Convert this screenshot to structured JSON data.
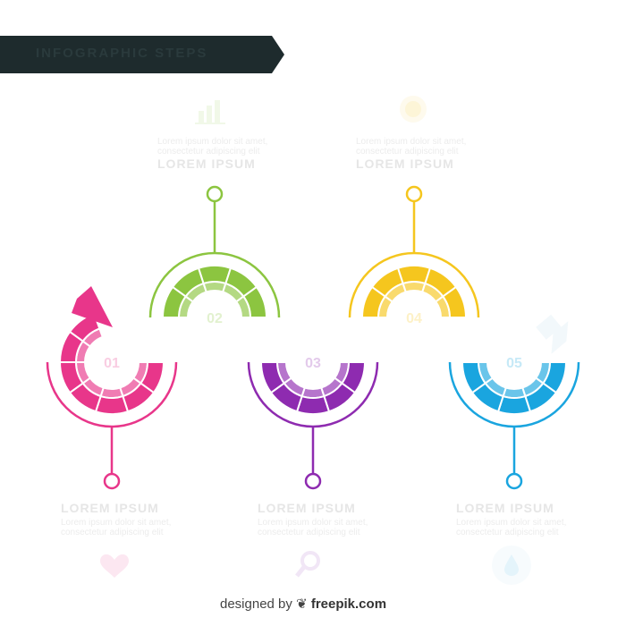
{
  "title": "INFOGRAPHIC STEPS",
  "colors": {
    "banner": "#1e2b2d",
    "pink": "#e8368a",
    "green": "#8cc540",
    "purple": "#8e2bb0",
    "yellow": "#f5c61e",
    "blue": "#1aa5df"
  },
  "steps": [
    {
      "number": "01",
      "heading": "LOREM IPSUM",
      "body": "Lorem ipsum dolor sit amet, consectetur adipiscing elit",
      "icon": "heart-icon",
      "color": "#e8368a"
    },
    {
      "number": "02",
      "heading": "LOREM IPSUM",
      "body": "Lorem ipsum dolor sit amet, consectetur adipiscing elit",
      "icon": "chart-icon",
      "color": "#8cc540"
    },
    {
      "number": "03",
      "heading": "LOREM IPSUM",
      "body": "Lorem ipsum dolor sit amet, consectetur adipiscing elit",
      "icon": "search-icon",
      "color": "#8e2bb0"
    },
    {
      "number": "04",
      "heading": "LOREM IPSUM",
      "body": "Lorem ipsum dolor sit amet, consectetur adipiscing elit",
      "icon": "lightbulb-icon",
      "color": "#f5c61e"
    },
    {
      "number": "05",
      "heading": "LOREM IPSUM",
      "body": "Lorem ipsum dolor sit amet, consectetur adipiscing elit",
      "icon": "drop-icon",
      "color": "#1aa5df"
    }
  ],
  "credit": {
    "prefix": "designed by",
    "brand": "freepik.com"
  }
}
